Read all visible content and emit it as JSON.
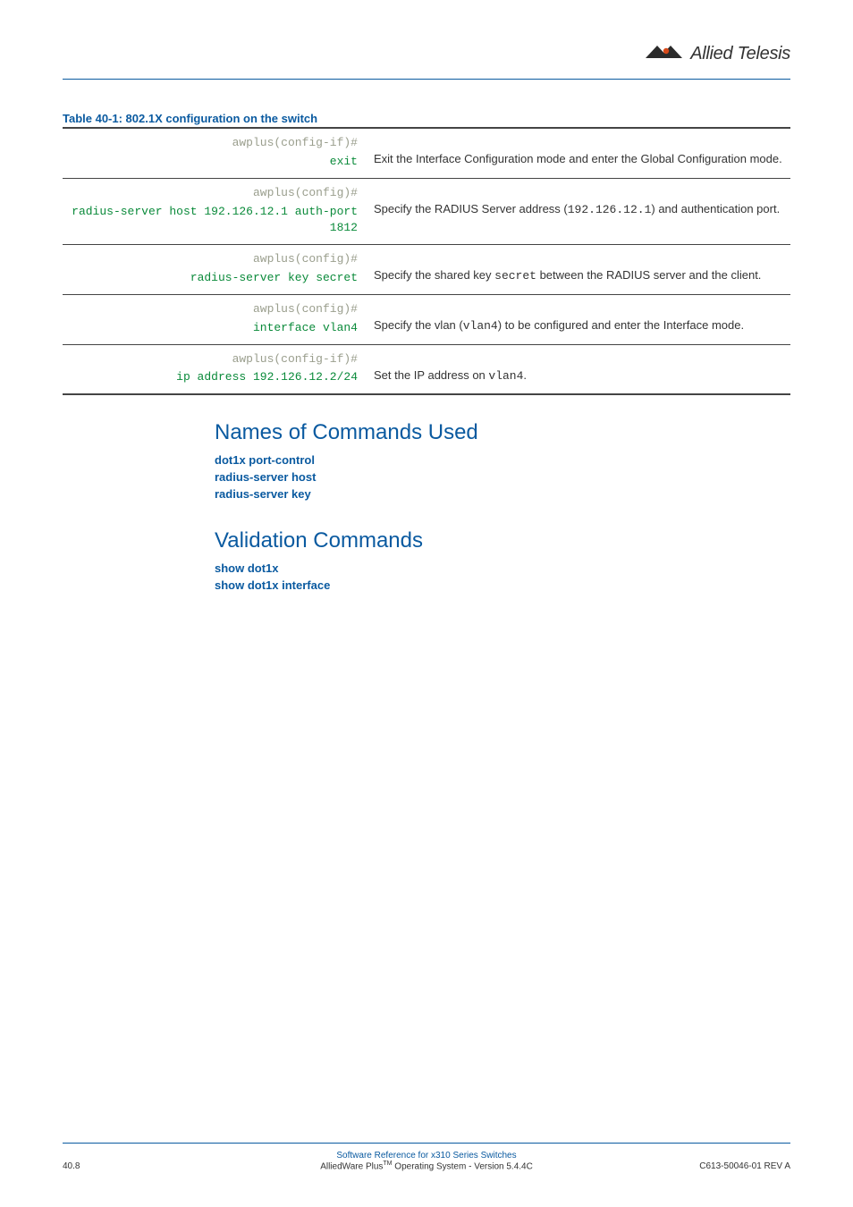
{
  "logo": {
    "brand": "Allied Telesis"
  },
  "table": {
    "title": "Table 40-1: 802.1X configuration on the switch",
    "rows": [
      {
        "prompt": "awplus(config-if)#",
        "cmd": "exit",
        "desc_pre": "Exit the Interface Configuration mode and enter the Global Configuration mode.",
        "code1": "",
        "mid1": "",
        "code2": "",
        "tail": ""
      },
      {
        "prompt": "awplus(config)#",
        "cmd": "radius-server host 192.126.12.1 auth-port 1812",
        "desc_pre": "Specify the RADIUS Server address (",
        "code1": "192.126.12.1",
        "mid1": ") and authentication port.",
        "code2": "",
        "tail": ""
      },
      {
        "prompt": "awplus(config)#",
        "cmd": "radius-server key secret",
        "desc_pre": "Specify the shared key ",
        "code1": "secret",
        "mid1": " between the RADIUS server and the client.",
        "code2": "",
        "tail": ""
      },
      {
        "prompt": "awplus(config)#",
        "cmd": "interface vlan4",
        "desc_pre": "Specify the vlan (",
        "code1": "vlan4",
        "mid1": ") to be configured and enter the Interface mode.",
        "code2": "",
        "tail": ""
      },
      {
        "prompt": "awplus(config-if)#",
        "cmd": "ip address 192.126.12.2/24",
        "desc_pre": "Set the IP address on ",
        "code1": "vlan4",
        "mid1": ".",
        "code2": "",
        "tail": ""
      }
    ]
  },
  "sections": {
    "names_heading": "Names of Commands Used",
    "names_links": [
      "dot1x port-control",
      "radius-server host",
      "radius-server key"
    ],
    "validation_heading": "Validation Commands",
    "validation_links": [
      "show dot1x",
      "show dot1x interface"
    ]
  },
  "footer": {
    "left": "40.8",
    "center1": "Software Reference for x310 Series Switches",
    "center2_pre": "AlliedWare Plus",
    "center2_tm": "TM",
    "center2_post": " Operating System  - Version 5.4.4C",
    "right": "C613-50046-01 REV A"
  }
}
